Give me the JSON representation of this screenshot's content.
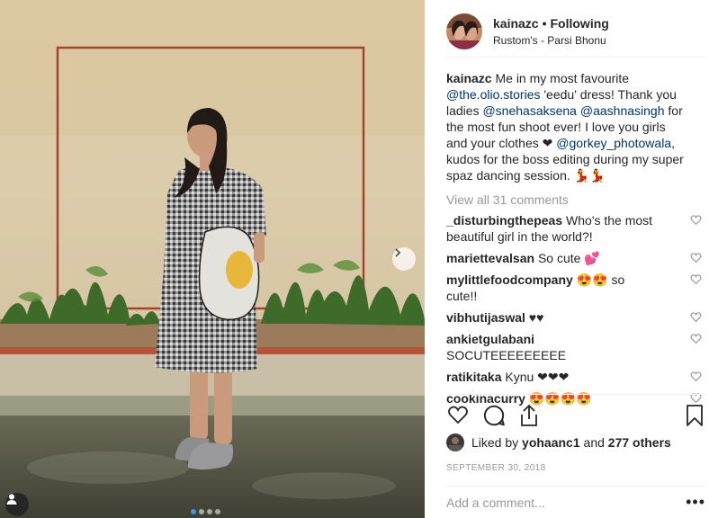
{
  "post": {
    "username": "kainazc",
    "separator": "•",
    "follow_label": "Following",
    "location": "Rustom's - Parsi Bhonu"
  },
  "caption": {
    "author": "kainazc",
    "t1": " Me in my most favourite ",
    "m1": "@the.olio.stories",
    "t2": " 'eedu' dress! Thank you ladies ",
    "m2": "@snehasaksena",
    "t3": " ",
    "m3": "@aashnasingh",
    "t4": " for the most fun shoot ever! I love you girls and your clothes ❤ ",
    "m4": "@gorkey_photowala",
    "t5": ", kudos for the boss editing during my super spaz dancing session. 💃💃"
  },
  "view_all_comments": "View all 31 comments",
  "comments": [
    {
      "user": "_disturbingthepeas",
      "text": " Who's the most beautiful girl in the world?!"
    },
    {
      "user": "mariettevalsan",
      "text": " So cute 💕"
    },
    {
      "user": "mylittlefoodcompany",
      "text": " 😍😍 so cute!!"
    },
    {
      "user": "vibhutijaswal",
      "text": " ♥♥"
    },
    {
      "user": "ankietgulabani",
      "text": " SOCUTEEEEEEEEE"
    },
    {
      "user": "ratikitaka",
      "text": " Kynu ❤❤❤"
    },
    {
      "user": "cookinacurry",
      "text": " 😍😍😍😍"
    }
  ],
  "likes": {
    "prefix": "Liked by ",
    "user": "yohaanc1",
    "middle": " and ",
    "count_text": "277 others"
  },
  "date": "SEPTEMBER 30, 2018",
  "add_comment_placeholder": "Add a comment...",
  "more_label": "•••",
  "carousel": {
    "total": 4,
    "active": 1
  },
  "icons": {
    "like": "heart-icon",
    "comment": "comment-icon",
    "share": "share-icon",
    "save": "bookmark-icon",
    "next": "chevron-right-icon",
    "tag": "user-tag-icon"
  },
  "colors": {
    "mention": "#003569",
    "meta": "#999999",
    "text": "#262626",
    "active_dot": "#3897f0"
  }
}
